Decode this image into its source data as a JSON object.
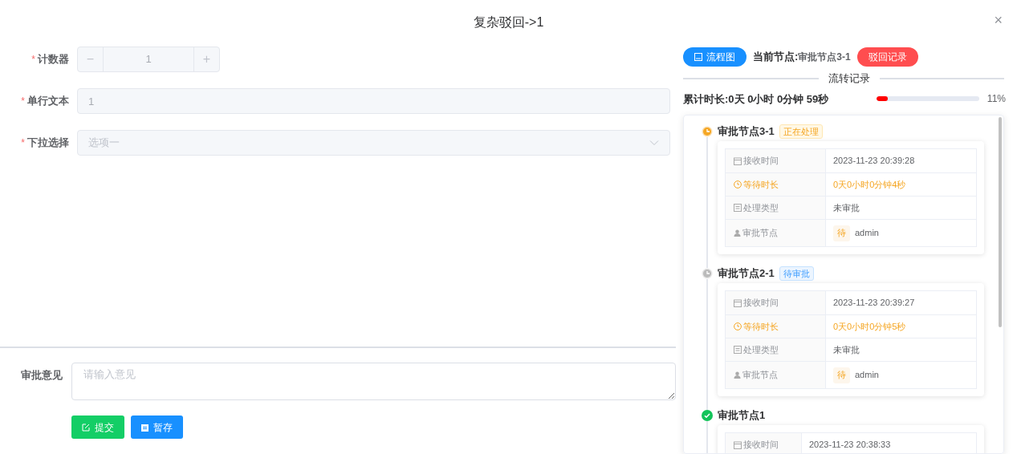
{
  "dialog": {
    "title": "复杂驳回->1",
    "close": "×"
  },
  "form": {
    "fields": [
      {
        "kind": "counter",
        "label": "计数器",
        "required_mark": "*",
        "disabled": true,
        "value": "1",
        "minus": "−",
        "plus": "+"
      },
      {
        "kind": "text",
        "label": "单行文本",
        "required_mark": "*",
        "disabled": true,
        "value": "1"
      },
      {
        "kind": "select",
        "label": "下拉选择",
        "required_mark": "*",
        "disabled": true,
        "placeholder": "选项一"
      }
    ]
  },
  "opinion": {
    "label": "审批意见",
    "placeholder": "请输入意见"
  },
  "actions": [
    {
      "kind": "submit",
      "label": "提交"
    },
    {
      "kind": "save",
      "label": "暂存"
    }
  ],
  "flow": {
    "chart_button": "流程图",
    "current_label": "当前节点:",
    "current_value": "审批节点3-1",
    "reject_button": "驳回记录",
    "section_title": "流转记录",
    "duration": "累计时长:0天 0小时 0分钟 59秒",
    "progress": {
      "level": 0.11,
      "reading": "11%"
    },
    "nodes": [
      {
        "title": "审批节点3-1",
        "kind": "processing",
        "tag": "正在处理",
        "rows": [
          {
            "kind": "time",
            "label": "接收时间",
            "value": "2023-11-23 20:39:28"
          },
          {
            "kind": "wait",
            "label": "等待时长",
            "value": "0天0小时0分钟4秒"
          },
          {
            "kind": "type",
            "label": "处理类型",
            "value": "未审批"
          },
          {
            "kind": "user",
            "label": "审批节点",
            "badge": "待",
            "value": "admin"
          }
        ]
      },
      {
        "title": "审批节点2-1",
        "kind": "pending",
        "tag": "待审批",
        "rows": [
          {
            "kind": "time",
            "label": "接收时间",
            "value": "2023-11-23 20:39:27"
          },
          {
            "kind": "wait",
            "label": "等待时长",
            "value": "0天0小时0分钟5秒"
          },
          {
            "kind": "type",
            "label": "处理类型",
            "value": "未审批"
          },
          {
            "kind": "user",
            "label": "审批节点",
            "badge": "待",
            "value": "admin"
          }
        ]
      },
      {
        "title": "审批节点1",
        "kind": "done",
        "rows": [
          {
            "kind": "time",
            "label": "接收时间",
            "value": "2023-11-23 20:38:33"
          }
        ]
      }
    ]
  }
}
